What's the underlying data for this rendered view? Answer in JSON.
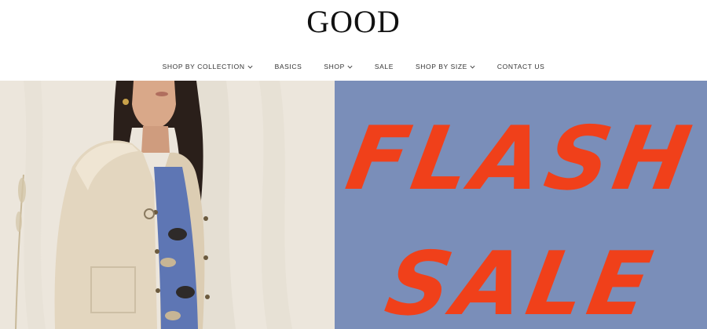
{
  "header": {
    "logo_text": "GOOD",
    "nav": [
      {
        "label": "SHOP BY COLLECTION",
        "has_dropdown": true
      },
      {
        "label": "BASICS",
        "has_dropdown": false
      },
      {
        "label": "SHOP",
        "has_dropdown": true
      },
      {
        "label": "SALE",
        "has_dropdown": false
      },
      {
        "label": "SHOP BY SIZE",
        "has_dropdown": true
      },
      {
        "label": "CONTACT US",
        "has_dropdown": false
      }
    ]
  },
  "hero": {
    "banner_line1": "FLASH",
    "banner_line2": "SALE",
    "banner_color": "#f0401a",
    "panel_color": "#7a8eb9",
    "photo_bg_color": "#ebe5db"
  }
}
